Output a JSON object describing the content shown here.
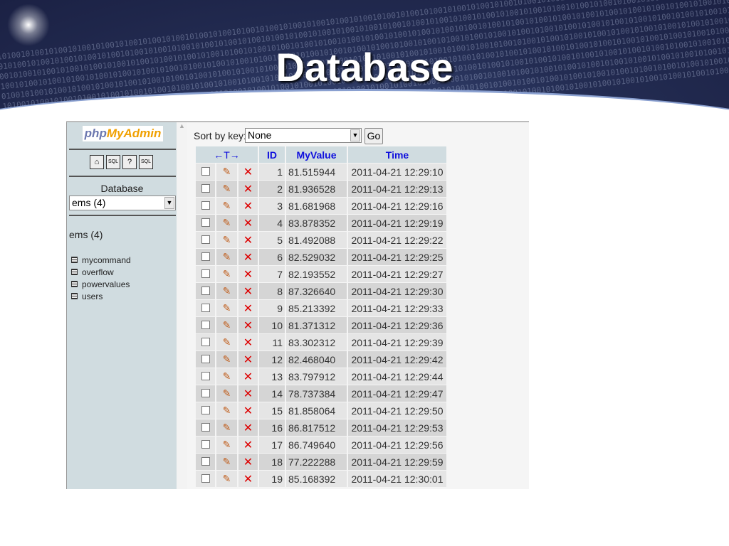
{
  "slide": {
    "title": "Database"
  },
  "sidebar": {
    "logo": "phpMyAdmin",
    "database_label": "Database",
    "database_selected": "ems (4)",
    "db_heading": "ems (4)",
    "tables": [
      "mycommand",
      "overflow",
      "powervalues",
      "users"
    ]
  },
  "main": {
    "sort_label": "Sort by key:",
    "sort_selected": "None",
    "go_label": "Go",
    "headers": {
      "nav": "←T→",
      "id": "ID",
      "value": "MyValue",
      "time": "Time"
    },
    "rows": [
      {
        "id": "1",
        "value": "81.515944",
        "time": "2011-04-21 12:29:10"
      },
      {
        "id": "2",
        "value": "81.936528",
        "time": "2011-04-21 12:29:13"
      },
      {
        "id": "3",
        "value": "81.681968",
        "time": "2011-04-21 12:29:16"
      },
      {
        "id": "4",
        "value": "83.878352",
        "time": "2011-04-21 12:29:19"
      },
      {
        "id": "5",
        "value": "81.492088",
        "time": "2011-04-21 12:29:22"
      },
      {
        "id": "6",
        "value": "82.529032",
        "time": "2011-04-21 12:29:25"
      },
      {
        "id": "7",
        "value": "82.193552",
        "time": "2011-04-21 12:29:27"
      },
      {
        "id": "8",
        "value": "87.326640",
        "time": "2011-04-21 12:29:30"
      },
      {
        "id": "9",
        "value": "85.213392",
        "time": "2011-04-21 12:29:33"
      },
      {
        "id": "10",
        "value": "81.371312",
        "time": "2011-04-21 12:29:36"
      },
      {
        "id": "11",
        "value": "83.302312",
        "time": "2011-04-21 12:29:39"
      },
      {
        "id": "12",
        "value": "82.468040",
        "time": "2011-04-21 12:29:42"
      },
      {
        "id": "13",
        "value": "83.797912",
        "time": "2011-04-21 12:29:44"
      },
      {
        "id": "14",
        "value": "78.737384",
        "time": "2011-04-21 12:29:47"
      },
      {
        "id": "15",
        "value": "81.858064",
        "time": "2011-04-21 12:29:50"
      },
      {
        "id": "16",
        "value": "86.817512",
        "time": "2011-04-21 12:29:53"
      },
      {
        "id": "17",
        "value": "86.749640",
        "time": "2011-04-21 12:29:56"
      },
      {
        "id": "18",
        "value": "77.222288",
        "time": "2011-04-21 12:29:59"
      },
      {
        "id": "19",
        "value": "85.168392",
        "time": "2011-04-21 12:30:01"
      }
    ]
  }
}
